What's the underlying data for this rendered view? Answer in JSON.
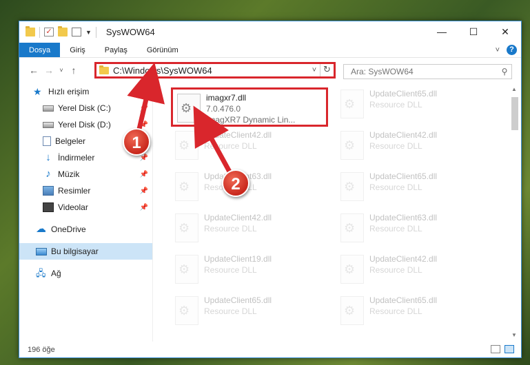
{
  "window": {
    "title": "SysWOW64",
    "controls": {
      "minimize": "—",
      "maximize": "☐",
      "close": "✕"
    }
  },
  "ribbon": {
    "tabs": [
      "Dosya",
      "Giriş",
      "Paylaş",
      "Görünüm"
    ],
    "collapse": "˅",
    "help": "?"
  },
  "toolbar": {
    "back": "←",
    "forward": "→",
    "recent": "˅",
    "up": "↑",
    "address": "C:\\Windows\\SysWOW64",
    "address_dropdown": "˅",
    "refresh": "↻",
    "search_placeholder": "Ara: SysWOW64",
    "search_icon": "⚲"
  },
  "sidebar": {
    "items": [
      {
        "label": "Hızlı erişim",
        "icon": "star-icon",
        "pinned": false
      },
      {
        "label": "Yerel Disk (C:)",
        "icon": "drive-icon",
        "pinned": true
      },
      {
        "label": "Yerel Disk (D:)",
        "icon": "drive-icon",
        "pinned": true
      },
      {
        "label": "Belgeler",
        "icon": "documents-icon",
        "pinned": true
      },
      {
        "label": "İndirmeler",
        "icon": "downloads-icon",
        "pinned": true
      },
      {
        "label": "Müzik",
        "icon": "music-icon",
        "pinned": true
      },
      {
        "label": "Resimler",
        "icon": "pictures-icon",
        "pinned": true
      },
      {
        "label": "Videolar",
        "icon": "videos-icon",
        "pinned": true
      },
      {
        "label": "OneDrive",
        "icon": "onedrive-icon",
        "pinned": false
      },
      {
        "label": "Bu bilgisayar",
        "icon": "this-pc-icon",
        "pinned": false,
        "selected": true
      },
      {
        "label": "Ağ",
        "icon": "network-icon",
        "pinned": false
      }
    ]
  },
  "files": [
    {
      "name": "imagxr7.dll",
      "line2": "7.0.476.0",
      "line3": "ImagXR7 Dynamic Lin...",
      "highlighted": true
    },
    {
      "name": "UpdateClient65.dll",
      "line2": "Resource DLL",
      "faded": true
    },
    {
      "name": "UpdateClient42.dll",
      "line2": "Resource DLL",
      "faded": true
    },
    {
      "name": "UpdateClient42.dll",
      "line2": "Resource DLL",
      "faded": true
    },
    {
      "name": "UpdateClient63.dll",
      "line2": "Resource DLL",
      "faded": true
    },
    {
      "name": "UpdateClient65.dll",
      "line2": "Resource DLL",
      "faded": true
    },
    {
      "name": "UpdateClient42.dll",
      "line2": "Resource DLL",
      "faded": true
    },
    {
      "name": "UpdateClient63.dll",
      "line2": "Resource DLL",
      "faded": true
    },
    {
      "name": "UpdateClient19.dll",
      "line2": "Resource DLL",
      "faded": true
    },
    {
      "name": "UpdateClient42.dll",
      "line2": "Resource DLL",
      "faded": true
    },
    {
      "name": "UpdateClient65.dll",
      "line2": "Resource DLL",
      "faded": true
    },
    {
      "name": "UpdateClient65.dll",
      "line2": "Resource DLL",
      "faded": true
    }
  ],
  "status": {
    "count": "196 öğe"
  },
  "annotations": {
    "callout_1": "1",
    "callout_2": "2",
    "color": "#d9262c"
  },
  "colors": {
    "accent": "#1979ca",
    "highlight_box": "#d9262c",
    "selected_bg": "#cce4f7"
  }
}
